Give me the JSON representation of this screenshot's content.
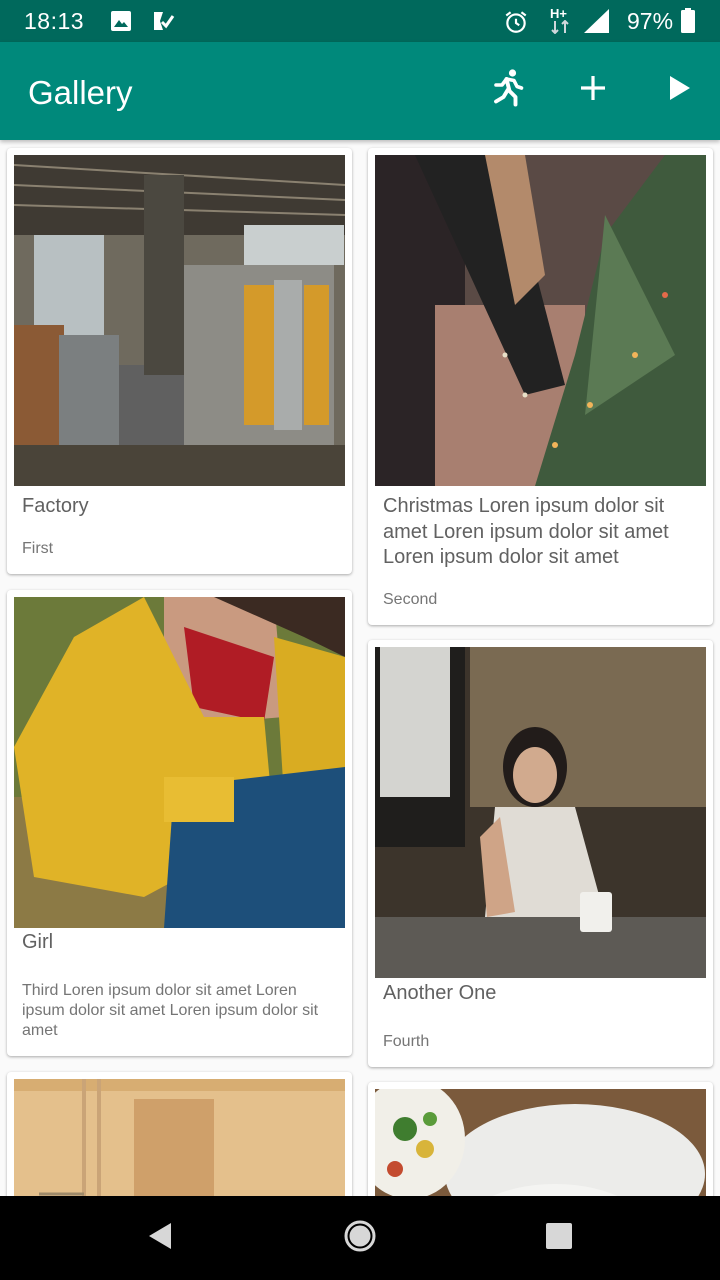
{
  "status_bar": {
    "time": "18:13",
    "network": "H+",
    "battery": "97%",
    "icons": [
      "image-icon",
      "task-check-icon",
      "alarm-icon",
      "signal-icon",
      "battery-icon"
    ]
  },
  "app_bar": {
    "title": "Gallery",
    "actions": [
      "run-icon",
      "add-icon",
      "play-icon"
    ],
    "color": "#00897b",
    "status_color": "#00695c"
  },
  "cards": [
    {
      "title": "Factory",
      "subtitle": "First",
      "photo": "factory-photo"
    },
    {
      "title": "Christmas Loren ipsum dolor sit amet Loren ipsum dolor sit amet Loren ipsum dolor sit amet",
      "subtitle": "Second",
      "photo": "christmas-tree-photo"
    },
    {
      "title": "Girl",
      "subtitle": "Third Loren ipsum dolor sit amet Loren ipsum dolor sit amet Loren ipsum dolor sit amet",
      "photo": "girl-yellow-jacket-photo"
    },
    {
      "title": "Another One",
      "subtitle": "Fourth",
      "photo": "woman-at-table-photo"
    },
    {
      "title": "",
      "subtitle": "",
      "photo": "wall-photo"
    },
    {
      "title": "",
      "subtitle": "",
      "photo": "food-plates-photo"
    }
  ],
  "nav_bar": {
    "buttons": [
      "back-icon",
      "home-icon",
      "recents-icon"
    ]
  }
}
